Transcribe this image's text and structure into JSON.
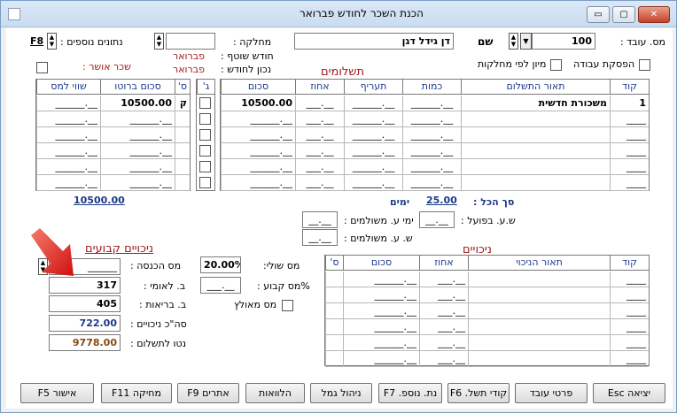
{
  "window": {
    "title": "הכנת השכר לחודש פברואר",
    "minimize": "▭",
    "restore": "▢",
    "close": "✕"
  },
  "header": {
    "employee_label": "מס. עובד :",
    "employee_value": "100",
    "name_label": "שם",
    "name_value": "דן גידל דגן",
    "dept_label": "מחלקה :",
    "dept_value": "",
    "extra_label": "נתונים נוספים :",
    "extra_key": "F8",
    "current_month_label": "חודש שוטף :",
    "current_month_value": "פברואר",
    "correct_month_label": "נכון לחודש :",
    "correct_month_value": "פברואר",
    "stop_work_label": "הפסקת עבודה",
    "sort_dept_label": "מיון לפי מחלקות",
    "happy_pay_label": "שכר אושר :"
  },
  "payments": {
    "title": "תשלומים",
    "columns": [
      "קוד",
      "תאור התשלום",
      "כמות",
      "תעריף",
      "אחוז",
      "סכום",
      "ג'",
      "שווי למס",
      "סכום ברוטו",
      "ס'"
    ],
    "rows": [
      {
        "code": "1",
        "desc": "משכורת חדשית",
        "qty": "______.__",
        "rate": "______.__",
        "pct": "___.__",
        "amount": "10500.00",
        "taxval": "______.__",
        "gross": "10500.00",
        "s": "ק"
      },
      {
        "code": "____",
        "desc": "",
        "qty": "______.__",
        "rate": "______.__",
        "pct": "___.__",
        "amount": "______.__",
        "taxval": "______.__",
        "gross": "______.__",
        "s": ""
      },
      {
        "code": "____",
        "desc": "",
        "qty": "______.__",
        "rate": "______.__",
        "pct": "___.__",
        "amount": "______.__",
        "taxval": "______.__",
        "gross": "______.__",
        "s": ""
      },
      {
        "code": "____",
        "desc": "",
        "qty": "______.__",
        "rate": "______.__",
        "pct": "___.__",
        "amount": "______.__",
        "taxval": "______.__",
        "gross": "______.__",
        "s": ""
      },
      {
        "code": "____",
        "desc": "",
        "qty": "______.__",
        "rate": "______.__",
        "pct": "___.__",
        "amount": "______.__",
        "taxval": "______.__",
        "gross": "______.__",
        "s": ""
      },
      {
        "code": "____",
        "desc": "",
        "qty": "______.__",
        "rate": "______.__",
        "pct": "___.__",
        "amount": "______.__",
        "taxval": "______.__",
        "gross": "______.__",
        "s": ""
      }
    ],
    "total_label": "סך הכל :",
    "total_days": "25.00",
    "days_label": "ימים",
    "total_gross": "10500.00",
    "actual_hours_label": "ש.ע. בפועל :",
    "paid_days_label": "ימי ע. משולמים :",
    "paid_hours_label": "ש. ע. משולמים :",
    "placeholder_small": "__.__"
  },
  "deductions": {
    "title": "ניכויים",
    "columns": [
      "קוד",
      "תאור הניכוי",
      "אחוז",
      "סכום",
      "ס'"
    ],
    "rows": [
      {
        "code": "____",
        "desc": "",
        "pct": "___.__",
        "amount": "______.__",
        "s": ""
      },
      {
        "code": "____",
        "desc": "",
        "pct": "___.__",
        "amount": "______.__",
        "s": ""
      },
      {
        "code": "____",
        "desc": "",
        "pct": "___.__",
        "amount": "______.__",
        "s": ""
      },
      {
        "code": "____",
        "desc": "",
        "pct": "___.__",
        "amount": "______.__",
        "s": ""
      },
      {
        "code": "____",
        "desc": "",
        "pct": "___.__",
        "amount": "______.__",
        "s": ""
      },
      {
        "code": "____",
        "desc": "",
        "pct": "___.__",
        "amount": "______.__",
        "s": ""
      }
    ]
  },
  "fixed": {
    "title": "ניכויים קבועים",
    "income_tax_label": "מס הכנסה :",
    "income_tax_value": "______",
    "national_ins_label": "ב. לאומי :",
    "national_ins_value": "317",
    "health_ins_label": "ב. בריאות :",
    "health_ins_value": "405",
    "total_ded_label": "סה\"כ ניכויים :",
    "total_ded_value": "722.00",
    "net_label": "נטו לתשלום :",
    "net_value": "9778.00",
    "marginal_label": "מס שולי:",
    "marginal_value": "20.00%",
    "fixed_tax_label": "%מס קבוע :",
    "fixed_tax_value": "___.__",
    "grossed_tax_label": "מס מאולץ"
  },
  "buttons": [
    "יציאה Esc",
    "פרטי עובד",
    "קודי תשל. F6",
    "נת. נוספ. F7",
    "ניהול גמל",
    "הלוואות",
    "אתרים F9",
    "מחיקה F11",
    "אישור F5"
  ],
  "colors": {
    "accent": "#1c3a8a",
    "label_red": "#a01818",
    "net": "#8a4a10",
    "arrow": "#e02020"
  }
}
